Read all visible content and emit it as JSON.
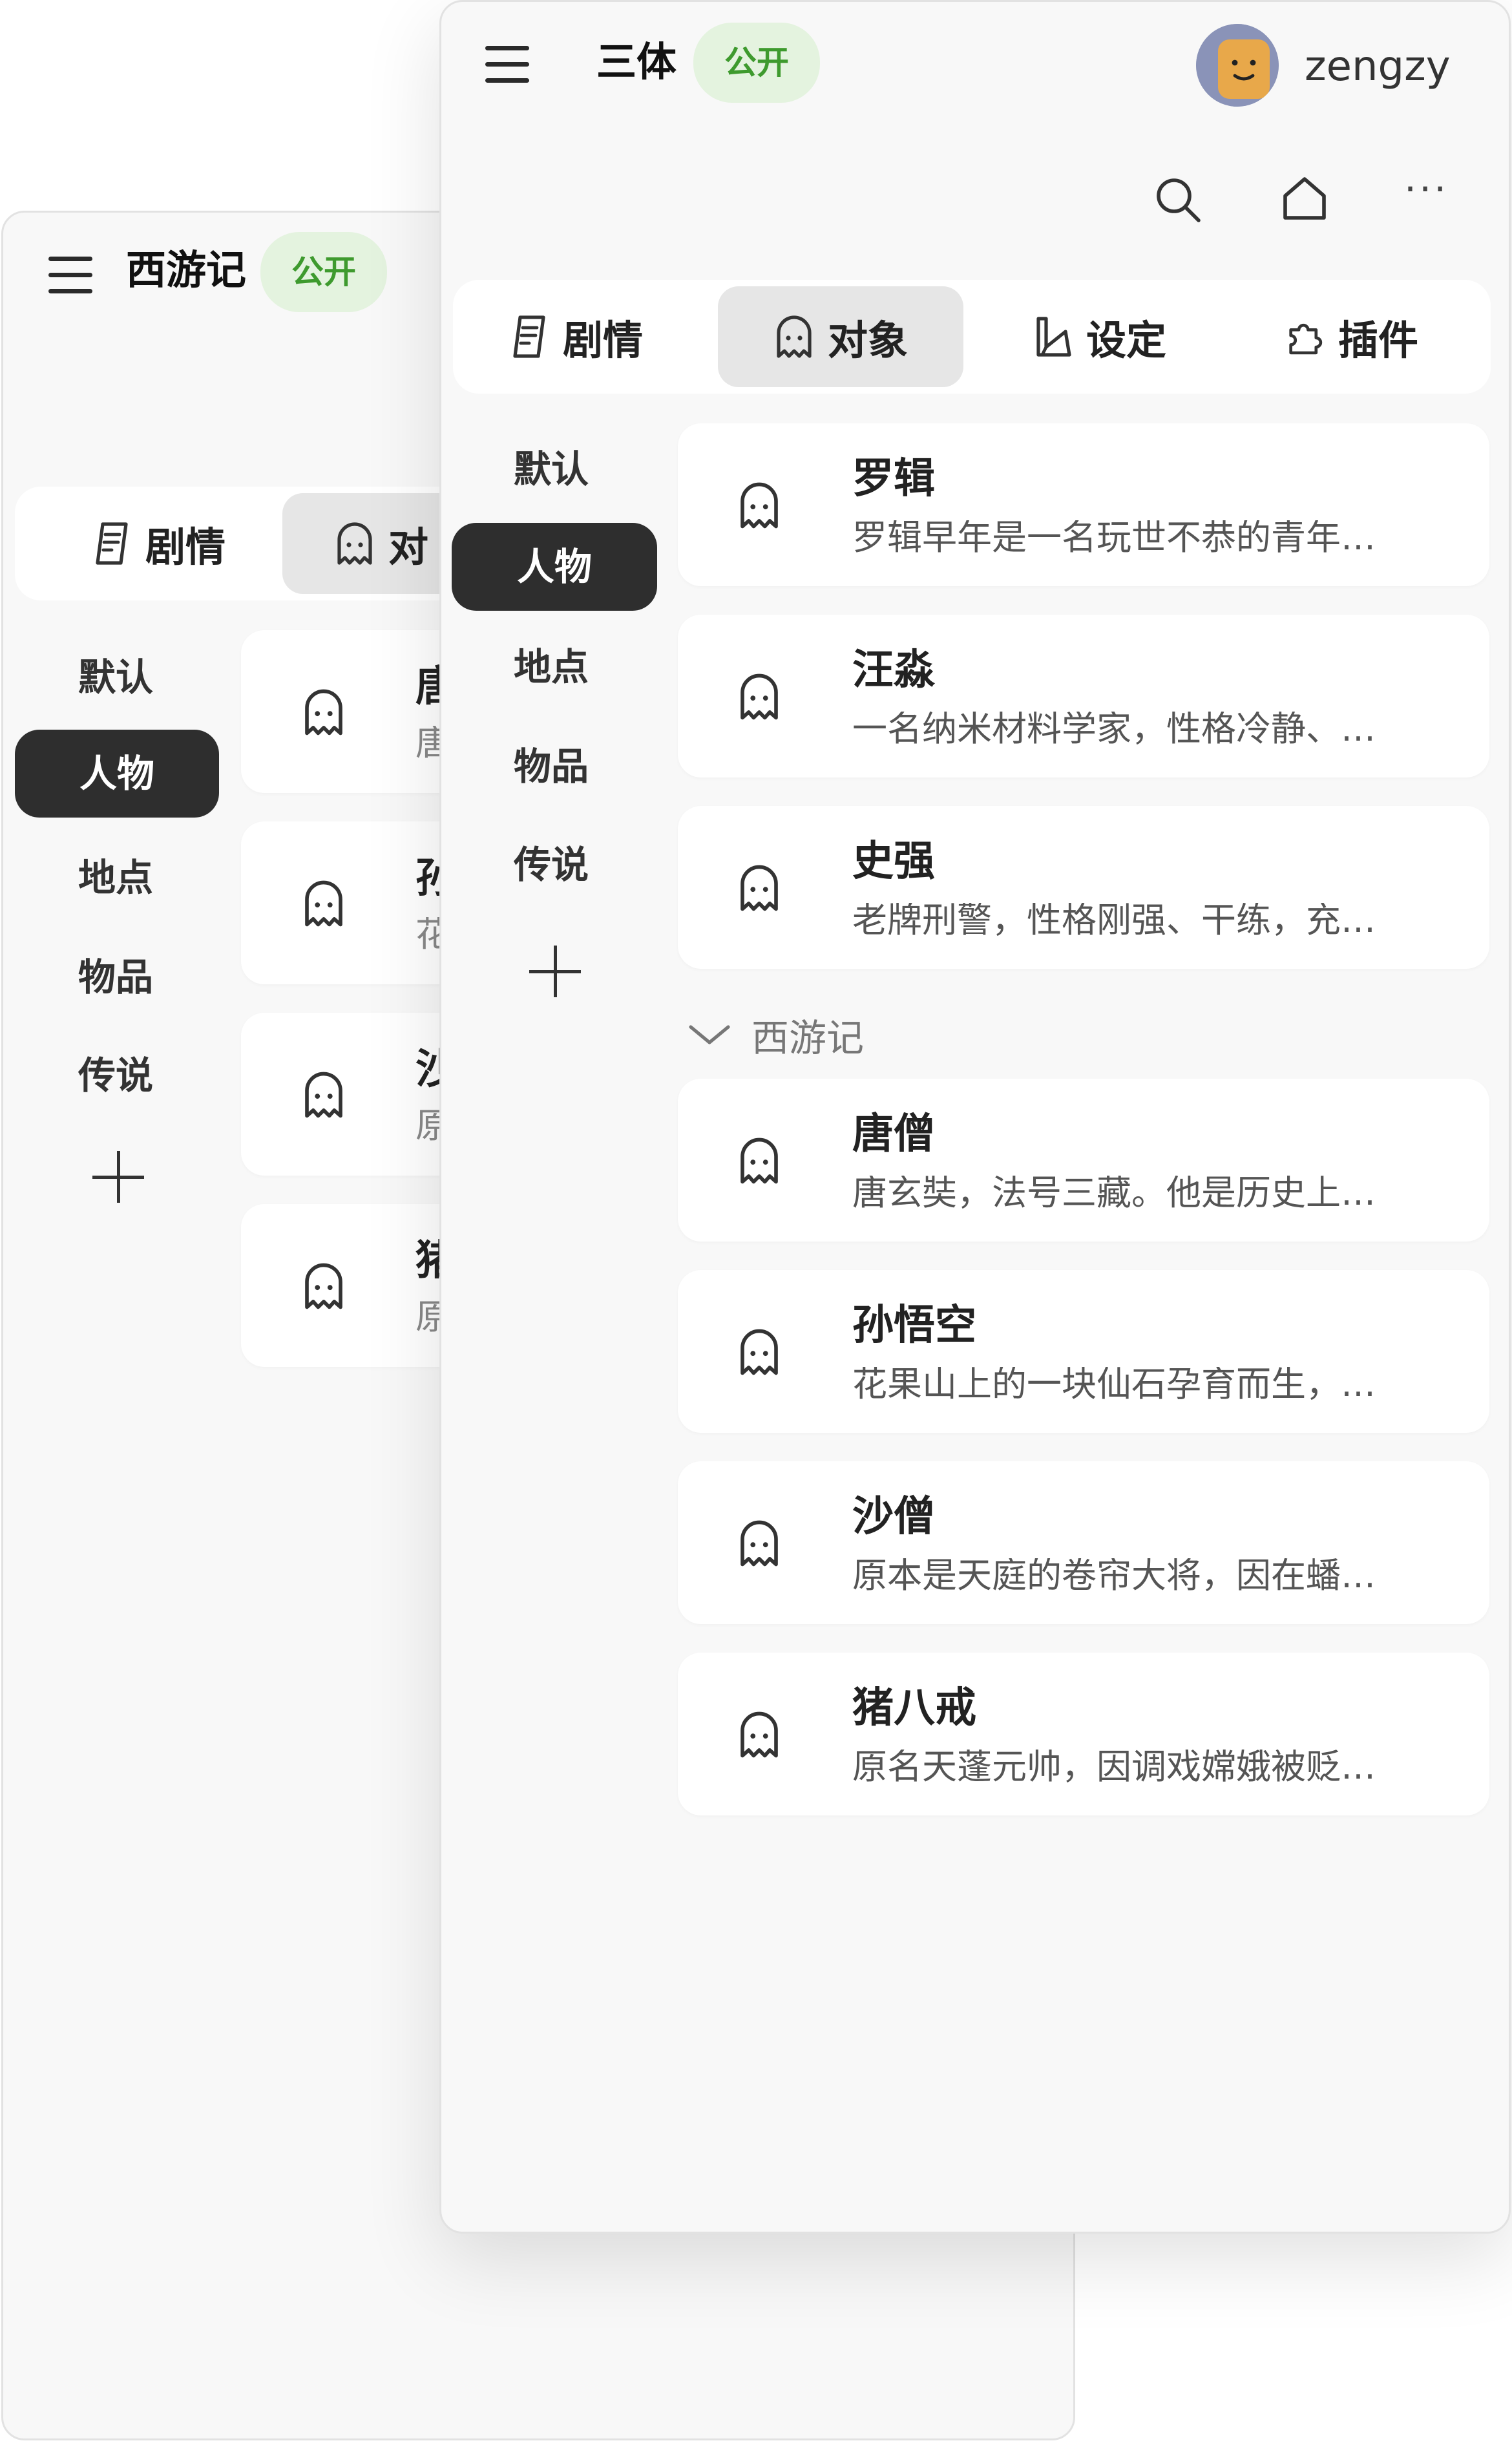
{
  "back_window": {
    "title": "西游记",
    "badge": "公开",
    "tabs": [
      {
        "label": "剧情",
        "icon": "document-icon"
      },
      {
        "label": "对",
        "icon": "ghost-icon"
      }
    ],
    "sidebar": [
      {
        "label": "默认"
      },
      {
        "label": "人物",
        "active": true
      },
      {
        "label": "地点"
      },
      {
        "label": "物品"
      },
      {
        "label": "传说"
      }
    ],
    "cards": [
      {
        "name": "唐",
        "desc": "唐"
      },
      {
        "name": "孙",
        "desc": "花"
      },
      {
        "name": "沙",
        "desc": "原"
      },
      {
        "name": "猪",
        "desc": "原"
      }
    ]
  },
  "front_window": {
    "title": "三体",
    "badge": "公开",
    "user": {
      "name": "zengzy",
      "avatar_color": "#e8a84a"
    },
    "toolbar": {
      "search_icon": "search-icon",
      "home_icon": "home-icon",
      "more_label": "···"
    },
    "tabs": [
      {
        "label": "剧情",
        "icon": "document-icon"
      },
      {
        "label": "对象",
        "icon": "ghost-icon",
        "active": true
      },
      {
        "label": "设定",
        "icon": "setting-book-icon"
      },
      {
        "label": "插件",
        "icon": "puzzle-icon"
      }
    ],
    "sidebar": [
      {
        "label": "默认"
      },
      {
        "label": "人物",
        "active": true
      },
      {
        "label": "地点"
      },
      {
        "label": "物品"
      },
      {
        "label": "传说"
      }
    ],
    "cards": [
      {
        "name": "罗辑",
        "desc": "罗辑早年是一名玩世不恭的青年…"
      },
      {
        "name": "汪淼",
        "desc": "一名纳米材料学家，性格冷静、…"
      },
      {
        "name": "史强",
        "desc": "老牌刑警，性格刚强、干练，充…"
      }
    ],
    "group": {
      "label": "西游记"
    },
    "group_cards": [
      {
        "name": "唐僧",
        "desc": "唐玄奘，法号三藏。他是历史上…"
      },
      {
        "name": "孙悟空",
        "desc": "花果山上的一块仙石孕育而生，…"
      },
      {
        "name": "沙僧",
        "desc": "原本是天庭的卷帘大将，因在蟠…"
      },
      {
        "name": "猪八戒",
        "desc": "原名天蓬元帅，因调戏嫦娥被贬…"
      }
    ]
  },
  "colors": {
    "accent_green": "#3e9a2e",
    "badge_bg": "#e4f3df",
    "active_dark": "#2e2e2e"
  }
}
